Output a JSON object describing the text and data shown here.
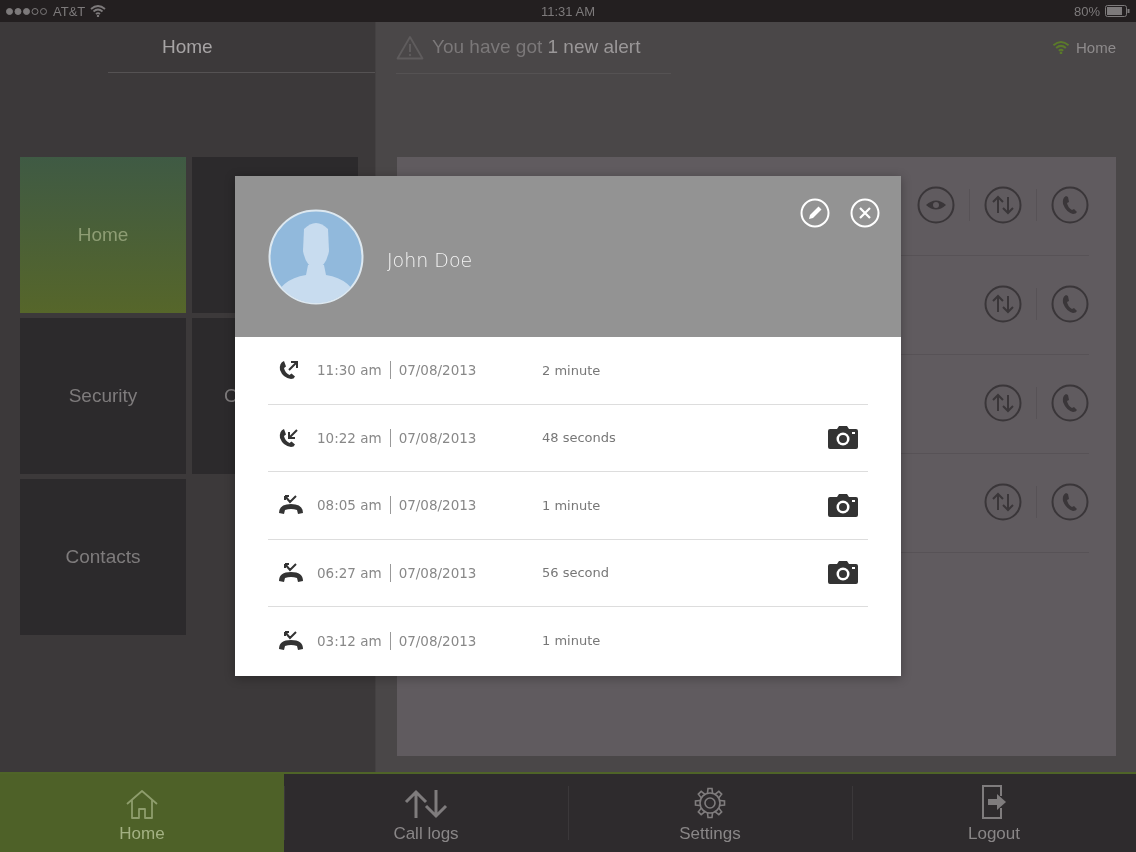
{
  "status_bar": {
    "carrier": "AT&T",
    "time": "11:31 AM",
    "battery": "80%"
  },
  "header": {
    "title": "Home",
    "alert": "You have got **1 new alert**",
    "network": "Home"
  },
  "tiles": [
    {
      "label": "Home",
      "selected": true
    },
    {
      "selected": false
    },
    {
      "label": "Security",
      "selected": false
    },
    {
      "label": "C",
      "selected": false
    },
    {
      "label": "Contacts",
      "selected": false
    }
  ],
  "contacts_panel": {
    "rows": [
      {
        "actions": [
          {
            "kind": "view"
          },
          {
            "kind": "transfer"
          },
          {
            "kind": "call"
          }
        ]
      },
      {
        "actions": [
          {
            "kind": "transfer"
          },
          {
            "kind": "call"
          }
        ]
      },
      {
        "actions": [
          {
            "kind": "transfer"
          },
          {
            "kind": "call"
          }
        ]
      },
      {
        "actions": [
          {
            "kind": "transfer"
          },
          {
            "kind": "call"
          }
        ]
      }
    ]
  },
  "modal": {
    "name": "John Doe",
    "calls": [
      {
        "kind": "outgoing",
        "time": "11:30 am",
        "date": "07/08/2013",
        "duration": "2 minute",
        "snapshot": false
      },
      {
        "kind": "incoming",
        "time": "10:22 am",
        "date": "07/08/2013",
        "duration": "48 seconds",
        "snapshot": true
      },
      {
        "kind": "missed",
        "time": "08:05 am",
        "date": "07/08/2013",
        "duration": "1 minute",
        "snapshot": true
      },
      {
        "kind": "missed",
        "time": "06:27 am",
        "date": "07/08/2013",
        "duration": "56 second",
        "snapshot": true
      },
      {
        "kind": "missed",
        "time": "03:12 am",
        "date": "07/08/2013",
        "duration": "1 minute",
        "snapshot": false
      }
    ]
  },
  "tab_bar": [
    {
      "kind": "home",
      "label": "Home",
      "selected": true
    },
    {
      "kind": "calls",
      "label": "Call logs",
      "selected": false
    },
    {
      "kind": "settings",
      "label": "Settings",
      "selected": false
    },
    {
      "kind": "logout",
      "label": "Logout",
      "selected": false
    }
  ]
}
